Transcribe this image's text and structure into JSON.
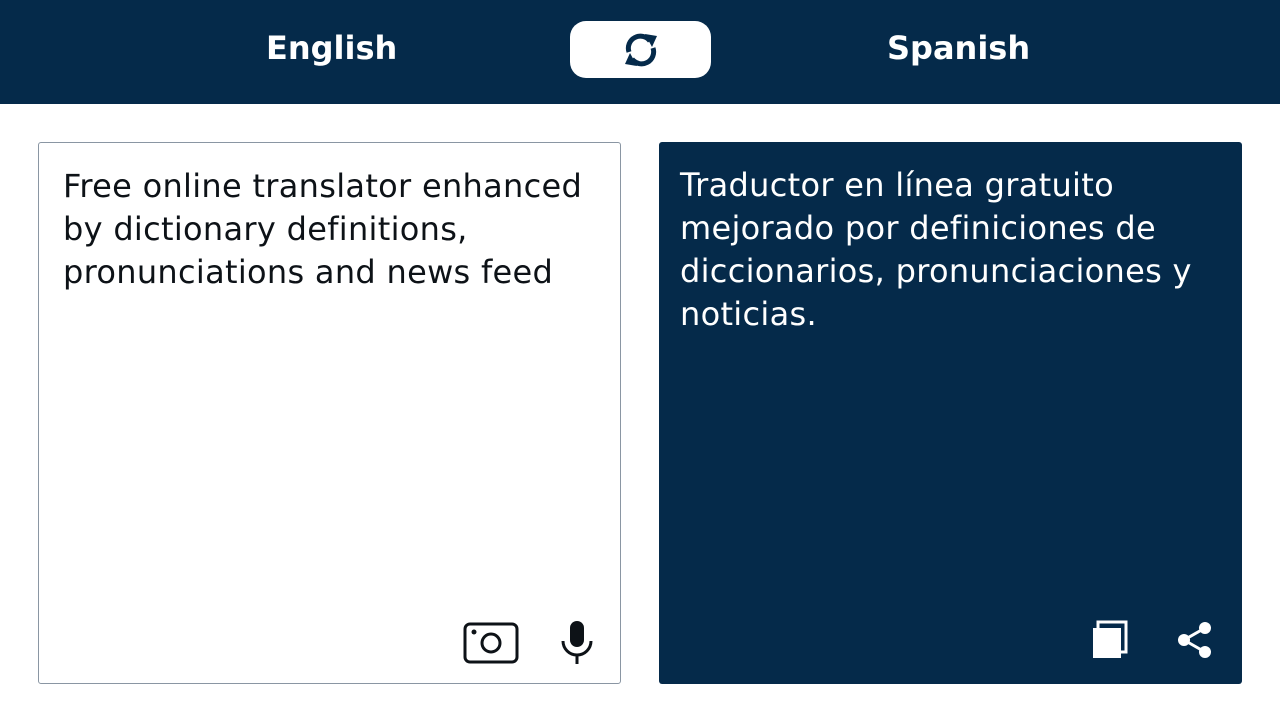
{
  "header": {
    "source_language": "English",
    "target_language": "Spanish",
    "swap_icon": "swap-arrows-icon"
  },
  "source_panel": {
    "text": "Free online translator enhanced by dictionary definitions, pronunciations and news feed",
    "icons": [
      "camera-icon",
      "microphone-icon"
    ]
  },
  "target_panel": {
    "text": "Traductor en línea gratuito mejorado por definiciones de diccionarios, pronunciaciones y noticias.",
    "icons": [
      "copy-icon",
      "share-icon"
    ]
  },
  "colors": {
    "brand_navy": "#052a4a",
    "background": "#ffffff",
    "source_border": "#8a96a3"
  }
}
